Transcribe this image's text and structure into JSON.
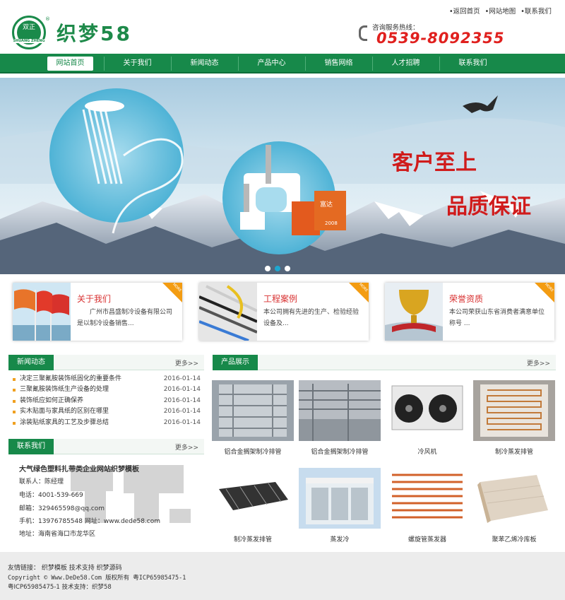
{
  "header": {
    "logo_text": "双正",
    "logo_sub": "SHUANG ZHENG",
    "brand": "织梦58",
    "reg_mark": "®",
    "top_links": [
      "•返回首页",
      "•网站地图",
      "•联系我们"
    ],
    "hotline_label": "咨询服务热线：",
    "hotline": "0539-8092355"
  },
  "nav": {
    "items": [
      "网站首页",
      "关于我们",
      "新闻动态",
      "产品中心",
      "销售网络",
      "人才招聘",
      "联系我们"
    ],
    "active": 0
  },
  "banner": {
    "slogan1": "客户至上",
    "slogan2": "品质保证",
    "box_label": "富达",
    "box_sub": "2008",
    "slide_count": 3,
    "active_slide": 1
  },
  "features": [
    {
      "title": "关于我们",
      "text": "广州市昌盛制冷设备有限公司是以制冷设备销售...",
      "badge": "MORE"
    },
    {
      "title": "工程案例",
      "text": "本公司拥有先进的生产、检验经验设备及...",
      "badge": "MORE"
    },
    {
      "title": "荣誉资质",
      "text": "本公司荣获山东省消费者满意单位称号 ...",
      "badge": "MORE"
    }
  ],
  "news": {
    "title": "新闻动态",
    "more": "更多>>",
    "items": [
      {
        "title": "决定三聚氰胺装饰纸固化的重要条件",
        "date": "2016-01-14"
      },
      {
        "title": "三聚氰胺装饰纸生产设备的处理",
        "date": "2016-01-14"
      },
      {
        "title": "装饰纸应如何正确保养",
        "date": "2016-01-14"
      },
      {
        "title": "实木贴面与家具纸的区别在哪里",
        "date": "2016-01-14"
      },
      {
        "title": "涂装贴纸家具的工艺及步骤总结",
        "date": "2016-01-14"
      }
    ]
  },
  "contact": {
    "title": "联系我们",
    "more": "更多>>",
    "company": "大气绿色塑料扎带类企业网站织梦模板",
    "person": "联系人：陈经理",
    "phone": "电话：4001-539-669",
    "email": "邮箱：329465598@qq.com",
    "mobile": "手机：13976785548  网址：www.dede58.com",
    "address": "地址：海南省海口市龙华区"
  },
  "products": {
    "title": "产品展示",
    "more": "更多>>",
    "items": [
      "铝合金搁架制冷排管",
      "铝合金搁架制冷排管",
      "冷风机",
      "制冷蒸发排管",
      "制冷蒸发排管",
      "蒸发冷",
      "螺旋管蒸发器",
      "聚苯乙烯冷库板"
    ]
  },
  "footer": {
    "links": "友情链接： 织梦模板  技术支持  织梦源码",
    "copyright": "Copyright © Www.DeDe58.Com 版权所有 粤ICP65985475-1",
    "icp": "粤ICP65985475-1 技术支持：织梦58"
  },
  "colors": {
    "brand_green": "#17894a",
    "hotline_red": "#e0201e",
    "more_orange": "#f39c12"
  }
}
